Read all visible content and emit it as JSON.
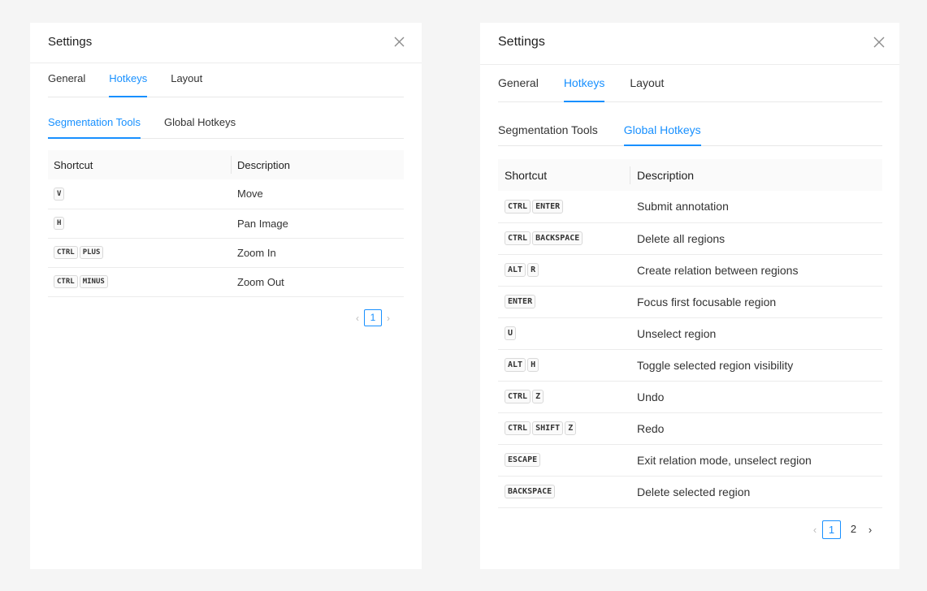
{
  "left": {
    "title": "Settings",
    "tabs": [
      {
        "label": "General",
        "active": false
      },
      {
        "label": "Hotkeys",
        "active": true
      },
      {
        "label": "Layout",
        "active": false
      }
    ],
    "subtabs": [
      {
        "label": "Segmentation Tools",
        "active": true
      },
      {
        "label": "Global Hotkeys",
        "active": false
      }
    ],
    "columns": [
      "Shortcut",
      "Description"
    ],
    "rows": [
      {
        "keys": [
          "V"
        ],
        "description": "Move"
      },
      {
        "keys": [
          "H"
        ],
        "description": "Pan Image"
      },
      {
        "keys": [
          "CTRL",
          "PLUS"
        ],
        "description": "Zoom In"
      },
      {
        "keys": [
          "CTRL",
          "MINUS"
        ],
        "description": "Zoom Out"
      }
    ],
    "pagination": {
      "pages": [
        "1"
      ],
      "current": "1"
    }
  },
  "right": {
    "title": "Settings",
    "tabs": [
      {
        "label": "General",
        "active": false
      },
      {
        "label": "Hotkeys",
        "active": true
      },
      {
        "label": "Layout",
        "active": false
      }
    ],
    "subtabs": [
      {
        "label": "Segmentation Tools",
        "active": false
      },
      {
        "label": "Global Hotkeys",
        "active": true
      }
    ],
    "columns": [
      "Shortcut",
      "Description"
    ],
    "rows": [
      {
        "keys": [
          "CTRL",
          "ENTER"
        ],
        "description": "Submit annotation"
      },
      {
        "keys": [
          "CTRL",
          "BACKSPACE"
        ],
        "description": "Delete all regions"
      },
      {
        "keys": [
          "ALT",
          "R"
        ],
        "description": "Create relation between regions"
      },
      {
        "keys": [
          "ENTER"
        ],
        "description": "Focus first focusable region"
      },
      {
        "keys": [
          "U"
        ],
        "description": "Unselect region"
      },
      {
        "keys": [
          "ALT",
          "H"
        ],
        "description": "Toggle selected region visibility"
      },
      {
        "keys": [
          "CTRL",
          "Z"
        ],
        "description": "Undo"
      },
      {
        "keys": [
          "CTRL",
          "SHIFT",
          "Z"
        ],
        "description": "Redo"
      },
      {
        "keys": [
          "ESCAPE"
        ],
        "description": "Exit relation mode, unselect region"
      },
      {
        "keys": [
          "BACKSPACE"
        ],
        "description": "Delete selected region"
      }
    ],
    "pagination": {
      "pages": [
        "1",
        "2"
      ],
      "current": "1",
      "next_enabled": true
    }
  },
  "icons": {
    "close": "close-icon",
    "prev": "chevron-left-icon",
    "next": "chevron-right-icon"
  },
  "colors": {
    "accent": "#1890ff",
    "background": "#f5f5f5",
    "panel": "#ffffff"
  }
}
